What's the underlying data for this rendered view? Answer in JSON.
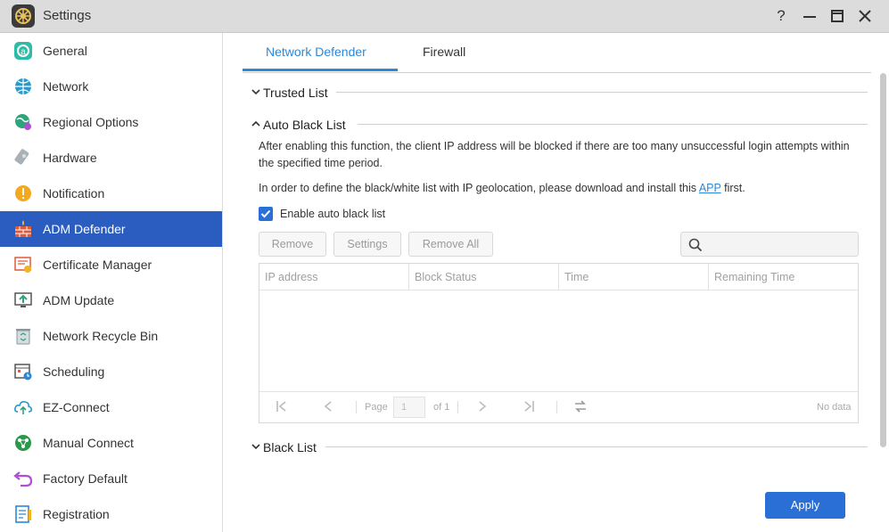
{
  "window": {
    "title": "Settings"
  },
  "sidebar": {
    "items": [
      {
        "label": "General"
      },
      {
        "label": "Network"
      },
      {
        "label": "Regional Options"
      },
      {
        "label": "Hardware"
      },
      {
        "label": "Notification"
      },
      {
        "label": "ADM Defender"
      },
      {
        "label": "Certificate Manager"
      },
      {
        "label": "ADM Update"
      },
      {
        "label": "Network Recycle Bin"
      },
      {
        "label": "Scheduling"
      },
      {
        "label": "EZ-Connect"
      },
      {
        "label": "Manual Connect"
      },
      {
        "label": "Factory Default"
      },
      {
        "label": "Registration"
      }
    ],
    "active": "ADM Defender"
  },
  "tabs": {
    "network_defender": "Network Defender",
    "firewall": "Firewall"
  },
  "sections": {
    "trusted_list": "Trusted List",
    "auto_black_list": "Auto Black List",
    "black_list": "Black List"
  },
  "auto_black_list": {
    "description": "After enabling this function, the client IP address will be blocked if there are too many unsuccessful login attempts within the specified time period.",
    "geo_prefix": "In order to define the black/white list with IP geolocation, please download and install this",
    "geo_link": "APP",
    "geo_suffix": "first.",
    "enable_label": "Enable auto black list",
    "enabled": true
  },
  "toolbar": {
    "remove": "Remove",
    "settings": "Settings",
    "remove_all": "Remove All"
  },
  "grid": {
    "columns": [
      "IP address",
      "Block Status",
      "Time",
      "Remaining Time"
    ],
    "rows": []
  },
  "pager": {
    "page_label": "Page",
    "page_value": "1",
    "of_label": "of 1",
    "status": "No data"
  },
  "footer": {
    "apply": "Apply"
  },
  "colors": {
    "accent": "#2a88d8",
    "active_bg": "#2a5dbf",
    "button_primary": "#2a6fd6"
  }
}
